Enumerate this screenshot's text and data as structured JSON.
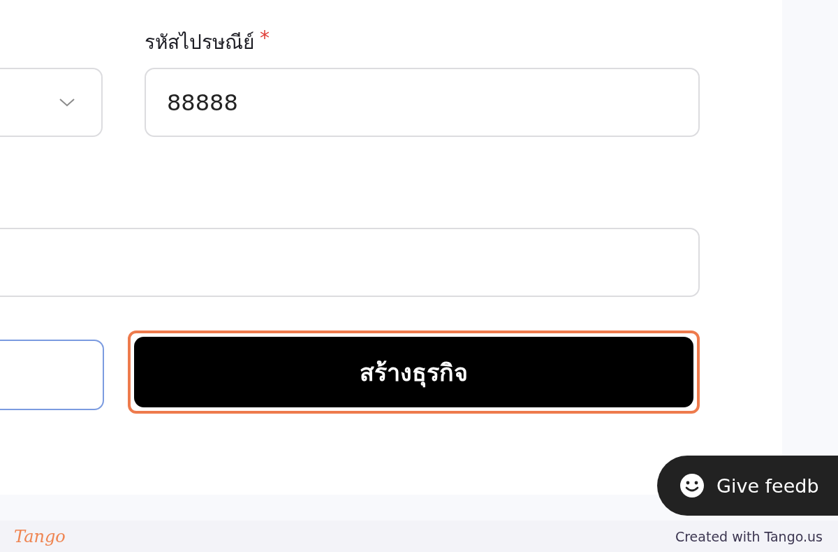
{
  "row1": [
    {
      "kind": "select"
    },
    {
      "kind": "text",
      "label": "รหัสไปรษณีย์",
      "required_mark": "*",
      "value": "88888"
    }
  ],
  "row2": [
    {
      "kind": "text"
    }
  ],
  "actions": [
    {
      "kind": "secondary",
      "highlighted": false
    },
    {
      "kind": "primary",
      "label": "สร้างธุรกิจ",
      "highlighted": true
    }
  ],
  "feedback_button": {
    "label": "Give feedb"
  },
  "footer": {
    "logo": "Tango",
    "credit": "Created with Tango.us"
  }
}
